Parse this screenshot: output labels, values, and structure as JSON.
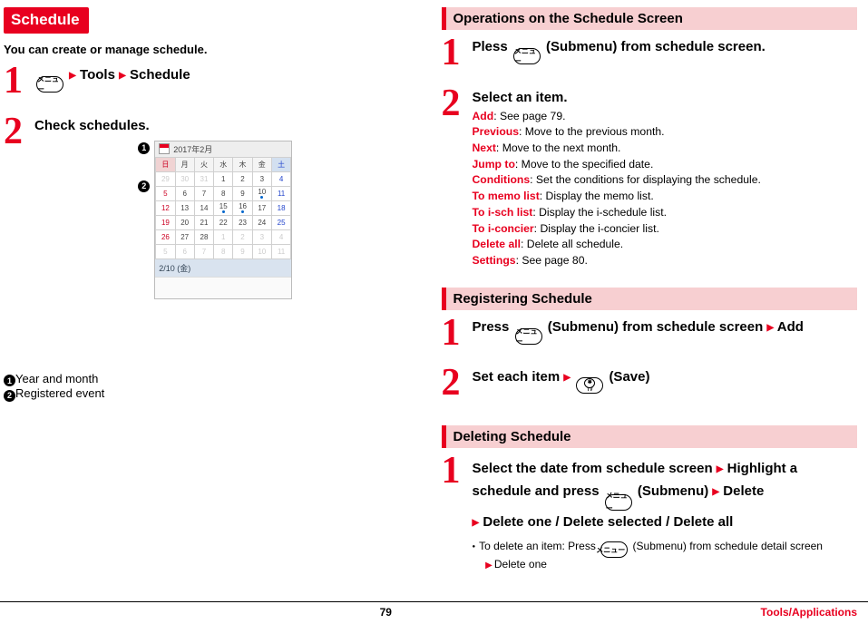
{
  "left": {
    "title": "Schedule",
    "intro": "You can create or manage schedule.",
    "step1": {
      "key_label": "メニュー",
      "arrow": "▶",
      "seg1": "Tools",
      "seg2": "Schedule"
    },
    "step2": {
      "title": "Check schedules."
    },
    "legend": {
      "l1": "Year and month",
      "l2": "Registered event"
    },
    "calendar": {
      "header": "2017年2月",
      "dow": [
        "日",
        "月",
        "火",
        "水",
        "木",
        "金",
        "土"
      ],
      "rows": [
        [
          {
            "v": "29",
            "dim": true,
            "sun": true
          },
          {
            "v": "30",
            "dim": true
          },
          {
            "v": "31",
            "dim": true
          },
          {
            "v": "1"
          },
          {
            "v": "2"
          },
          {
            "v": "3"
          },
          {
            "v": "4",
            "sat": true
          }
        ],
        [
          {
            "v": "5",
            "sun": true
          },
          {
            "v": "6"
          },
          {
            "v": "7"
          },
          {
            "v": "8"
          },
          {
            "v": "9"
          },
          {
            "v": "10",
            "dot": true
          },
          {
            "v": "11",
            "sat": true
          }
        ],
        [
          {
            "v": "12",
            "sun": true
          },
          {
            "v": "13"
          },
          {
            "v": "14"
          },
          {
            "v": "15",
            "dot": true
          },
          {
            "v": "16",
            "dot": true
          },
          {
            "v": "17"
          },
          {
            "v": "18",
            "sat": true
          }
        ],
        [
          {
            "v": "19",
            "sun": true
          },
          {
            "v": "20"
          },
          {
            "v": "21"
          },
          {
            "v": "22"
          },
          {
            "v": "23"
          },
          {
            "v": "24"
          },
          {
            "v": "25",
            "sat": true
          }
        ],
        [
          {
            "v": "26",
            "sun": true
          },
          {
            "v": "27"
          },
          {
            "v": "28"
          },
          {
            "v": "1",
            "dim": true
          },
          {
            "v": "2",
            "dim": true
          },
          {
            "v": "3",
            "dim": true
          },
          {
            "v": "4",
            "dim": true,
            "sat": true
          }
        ],
        [
          {
            "v": "5",
            "dim": true,
            "sun": true
          },
          {
            "v": "6",
            "dim": true
          },
          {
            "v": "7",
            "dim": true
          },
          {
            "v": "8",
            "dim": true
          },
          {
            "v": "9",
            "dim": true
          },
          {
            "v": "10",
            "dim": true
          },
          {
            "v": "11",
            "dim": true,
            "sat": true
          }
        ]
      ],
      "footer": "2/10 (金)"
    }
  },
  "right": {
    "ops": {
      "heading": "Operations on the Schedule Screen",
      "step1": {
        "pre": "Pless ",
        "key": "メニュー",
        "post": " (Submenu) from schedule screen."
      },
      "step2_title": "Select an item.",
      "items": [
        {
          "k": "Add",
          "t": ": See page 79."
        },
        {
          "k": "Previous",
          "t": ": Move to the previous month."
        },
        {
          "k": "Next",
          "t": ": Move to the next month."
        },
        {
          "k": "Jump to",
          "t": ": Move to the specified date."
        },
        {
          "k": "Conditions",
          "t": ": Set the conditions for displaying the schedule."
        },
        {
          "k": "To memo list",
          "t": ": Display the memo list."
        },
        {
          "k": "To i-sch list",
          "t": ": Display the i-schedule list."
        },
        {
          "k": "To i-concier",
          "t": ": Display the i-concier list."
        },
        {
          "k": "Delete all",
          "t": ": Delete all schedule."
        },
        {
          "k": "Settings",
          "t": ": See page 80."
        }
      ]
    },
    "reg": {
      "heading": "Registering Schedule",
      "step1": {
        "pre": "Press ",
        "key": "メニュー",
        "mid": " (Submenu) from schedule screen ",
        "tri": "▶",
        "post": " Add"
      },
      "step2": {
        "pre": "Set each item ",
        "tri": "▶",
        "key_inner": "⏀",
        "post": " (Save)"
      }
    },
    "del": {
      "heading": "Deleting Schedule",
      "step1_line1a": "Select the date from schedule screen ",
      "step1_line1b": " Highlight a",
      "step1_line2a": "schedule and press ",
      "step1_line2b": " (Submenu) ",
      "step1_line2c": " Delete",
      "step1_line3": " Delete one / Delete selected / Delete all",
      "key": "メニュー",
      "tri": "▶",
      "note_pre": "To delete an item: Press ",
      "note_mid": " (Submenu) from schedule detail screen",
      "note_sub": "Delete one"
    }
  },
  "footer": {
    "page": "79",
    "section": "Tools/Applications"
  }
}
